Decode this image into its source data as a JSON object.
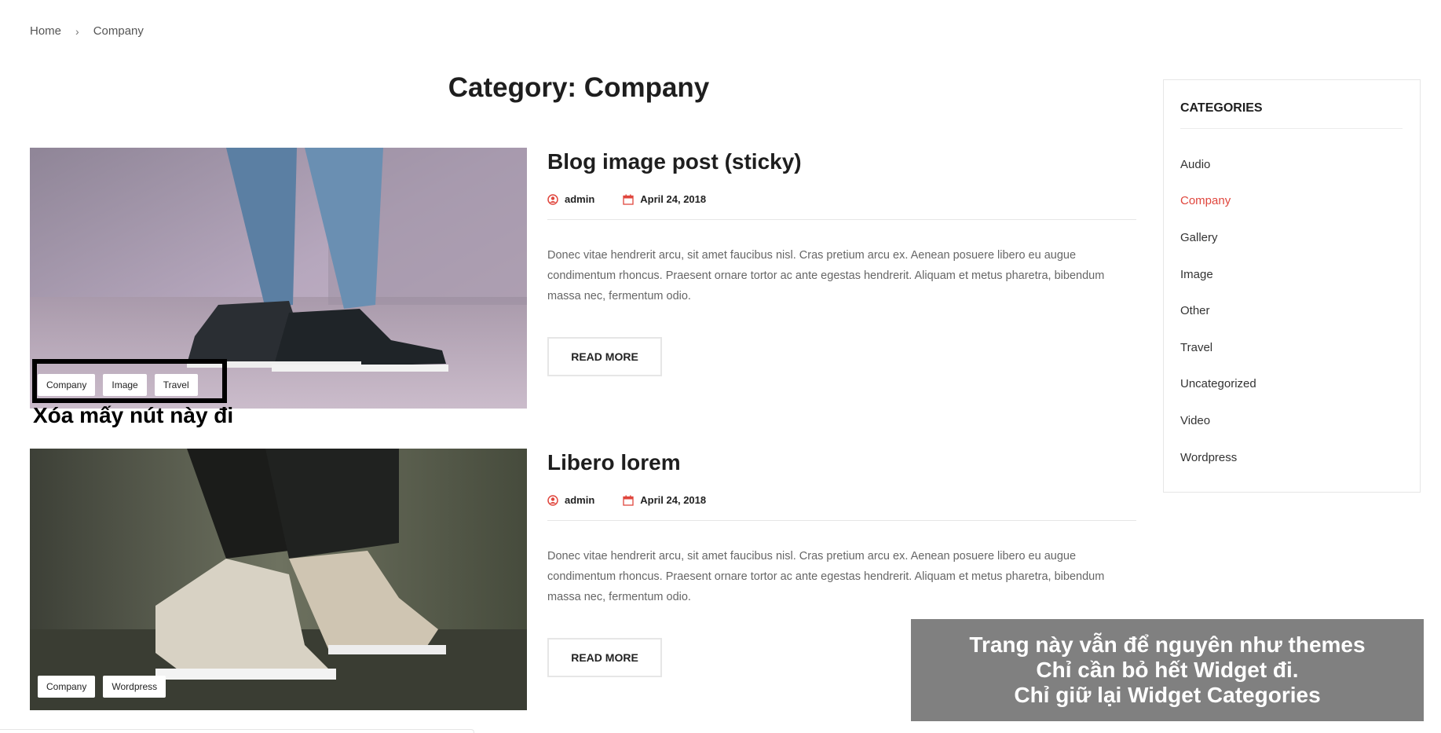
{
  "breadcrumb": {
    "home": "Home",
    "separator": "›",
    "current": "Company"
  },
  "page_title": "Category: Company",
  "posts": [
    {
      "title": "Blog image post (sticky)",
      "author": "admin",
      "date": "April 24, 2018",
      "excerpt": "Donec vitae hendrerit arcu, sit amet faucibus nisl. Cras pretium arcu ex. Aenean posuere libero eu augue condimentum rhoncus. Praesent ornare tortor ac ante egestas hendrerit. Aliquam et metus pharetra, bibendum massa nec, fermentum odio.",
      "read_more": "READ MORE",
      "tags": [
        "Company",
        "Image",
        "Travel"
      ]
    },
    {
      "title": "Libero lorem",
      "author": "admin",
      "date": "April 24, 2018",
      "excerpt": "Donec vitae hendrerit arcu, sit amet faucibus nisl. Cras pretium arcu ex. Aenean posuere libero eu augue condimentum rhoncus. Praesent ornare tortor ac ante egestas hendrerit. Aliquam et metus pharetra, bibendum massa nec, fermentum odio.",
      "read_more": "READ MORE",
      "tags": [
        "Company",
        "Wordpress"
      ]
    }
  ],
  "annotation": {
    "text": "Xóa mấy nút này đi"
  },
  "sidebar": {
    "title": "CATEGORIES",
    "categories": [
      "Audio",
      "Company",
      "Gallery",
      "Image",
      "Other",
      "Travel",
      "Uncategorized",
      "Video",
      "Wordpress"
    ],
    "active": "Company"
  },
  "note": {
    "line1": "Trang này vẫn để nguyên như themes",
    "line2": "Chỉ cần bỏ hết Widget đi.",
    "line3": "Chỉ giữ lại Widget Categories"
  },
  "colors": {
    "accent": "#e0463d",
    "note_bg": "#808080"
  },
  "icons": {
    "author": "user-circle-icon",
    "date": "calendar-icon"
  }
}
